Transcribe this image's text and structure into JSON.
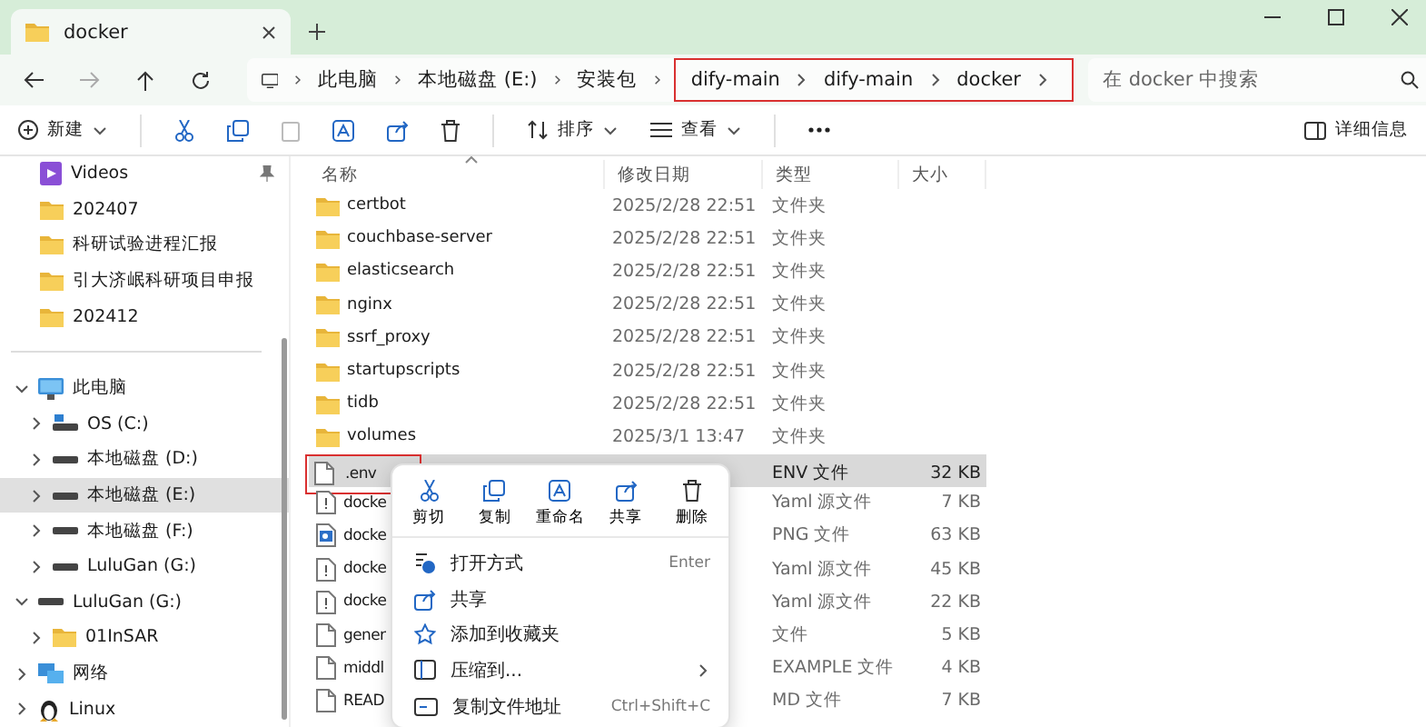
{
  "tab": {
    "title": "docker"
  },
  "breadcrumb": [
    {
      "label": "此电脑",
      "highlighted": false
    },
    {
      "label": "本地磁盘 (E:)",
      "highlighted": false
    },
    {
      "label": "安装包",
      "highlighted": false
    },
    {
      "label": "dify-main",
      "highlighted": true
    },
    {
      "label": "dify-main",
      "highlighted": true
    },
    {
      "label": "docker",
      "highlighted": true
    }
  ],
  "search": {
    "placeholder": "在 docker 中搜索"
  },
  "toolbar": {
    "new": "新建",
    "sort": "排序",
    "view": "查看",
    "details": "详细信息"
  },
  "sidebar": {
    "quick_access": [
      {
        "label": "Videos",
        "kind": "videos",
        "pinned": true
      },
      {
        "label": "202407",
        "kind": "folder",
        "pinned": false
      },
      {
        "label": "科研试验进程汇报",
        "kind": "folder",
        "pinned": false
      },
      {
        "label": "引大济岷科研项目申报",
        "kind": "folder",
        "pinned": false
      },
      {
        "label": "202412",
        "kind": "folder",
        "pinned": false
      }
    ],
    "tree": [
      {
        "label": "此电脑",
        "kind": "pc",
        "expanded": true,
        "selected": false,
        "children": [
          {
            "label": "OS (C:)",
            "kind": "osdrive",
            "expanded": false,
            "selected": false
          },
          {
            "label": "本地磁盘 (D:)",
            "kind": "drive",
            "expanded": false,
            "selected": false
          },
          {
            "label": "本地磁盘 (E:)",
            "kind": "drive",
            "expanded": false,
            "selected": true
          },
          {
            "label": "本地磁盘 (F:)",
            "kind": "drive",
            "expanded": false,
            "selected": false
          },
          {
            "label": "LuluGan (G:)",
            "kind": "drive",
            "expanded": false,
            "selected": false
          }
        ]
      },
      {
        "label": "LuluGan (G:)",
        "kind": "drive",
        "expanded": true,
        "selected": false,
        "children": [
          {
            "label": "01InSAR",
            "kind": "folder",
            "expanded": false,
            "selected": false
          }
        ]
      },
      {
        "label": "网络",
        "kind": "network",
        "expanded": false,
        "selected": false
      },
      {
        "label": "Linux",
        "kind": "linux",
        "expanded": false,
        "selected": false
      }
    ]
  },
  "table": {
    "columns": [
      "名称",
      "修改日期",
      "类型",
      "大小"
    ],
    "rows": [
      {
        "name": "certbot",
        "kind": "folder",
        "date": "2025/2/28 22:51",
        "type": "文件夹",
        "selected": false,
        "highlighted": false
      },
      {
        "name": "couchbase-server",
        "kind": "folder",
        "date": "2025/2/28 22:51",
        "type": "文件夹",
        "selected": false,
        "highlighted": false
      },
      {
        "name": "elasticsearch",
        "kind": "folder",
        "date": "2025/2/28 22:51",
        "type": "文件夹",
        "selected": false,
        "highlighted": false
      },
      {
        "name": "nginx",
        "kind": "folder",
        "date": "2025/2/28 22:51",
        "type": "文件夹",
        "selected": false,
        "highlighted": false
      },
      {
        "name": "ssrf_proxy",
        "kind": "folder",
        "date": "2025/2/28 22:51",
        "type": "文件夹",
        "selected": false,
        "highlighted": false
      },
      {
        "name": "startupscripts",
        "kind": "folder",
        "date": "2025/2/28 22:51",
        "type": "文件夹",
        "selected": false,
        "highlighted": false
      },
      {
        "name": "tidb",
        "kind": "folder",
        "date": "2025/2/28 22:51",
        "type": "文件夹",
        "selected": false,
        "highlighted": false
      },
      {
        "name": "volumes",
        "kind": "folder",
        "date": "2025/3/1 13:47",
        "type": "文件夹",
        "selected": false,
        "highlighted": false
      },
      {
        "name": ".env",
        "kind": "file",
        "type": "ENV 文件",
        "size": "32 KB",
        "selected": true,
        "highlighted": true
      },
      {
        "name": "docke",
        "kind": "yaml",
        "type": "Yaml 源文件",
        "size": "7 KB",
        "selected": false,
        "highlighted": false
      },
      {
        "name": "docke",
        "kind": "image",
        "type": "PNG 文件",
        "size": "63 KB",
        "selected": false,
        "highlighted": false
      },
      {
        "name": "docke",
        "kind": "yaml",
        "type": "Yaml 源文件",
        "size": "45 KB",
        "selected": false,
        "highlighted": false
      },
      {
        "name": "docke",
        "kind": "yaml",
        "type": "Yaml 源文件",
        "size": "22 KB",
        "selected": false,
        "highlighted": false
      },
      {
        "name": "gener",
        "kind": "file",
        "type": "文件",
        "size": "5 KB",
        "selected": false,
        "highlighted": false
      },
      {
        "name": "middl",
        "kind": "file",
        "type": "EXAMPLE 文件",
        "size": "4 KB",
        "selected": false,
        "highlighted": false
      },
      {
        "name": "READ",
        "kind": "file",
        "type": "MD 文件",
        "size": "7 KB",
        "selected": false,
        "highlighted": false
      }
    ]
  },
  "context_menu": {
    "quick_actions": [
      {
        "label": "剪切",
        "kind": "cut"
      },
      {
        "label": "复制",
        "kind": "copy"
      },
      {
        "label": "重命名",
        "kind": "rename"
      },
      {
        "label": "共享",
        "kind": "share"
      },
      {
        "label": "删除",
        "kind": "delete"
      }
    ],
    "items": [
      {
        "label": "打开方式",
        "kind": "open",
        "shortcut": "Enter",
        "submenu": false
      },
      {
        "label": "共享",
        "kind": "share",
        "submenu": false
      },
      {
        "label": "添加到收藏夹",
        "kind": "star",
        "submenu": false
      },
      {
        "label": "压缩到...",
        "kind": "zip",
        "submenu": true
      },
      {
        "label": "复制文件地址",
        "kind": "path",
        "shortcut": "Ctrl+Shift+C",
        "submenu": false
      }
    ]
  }
}
